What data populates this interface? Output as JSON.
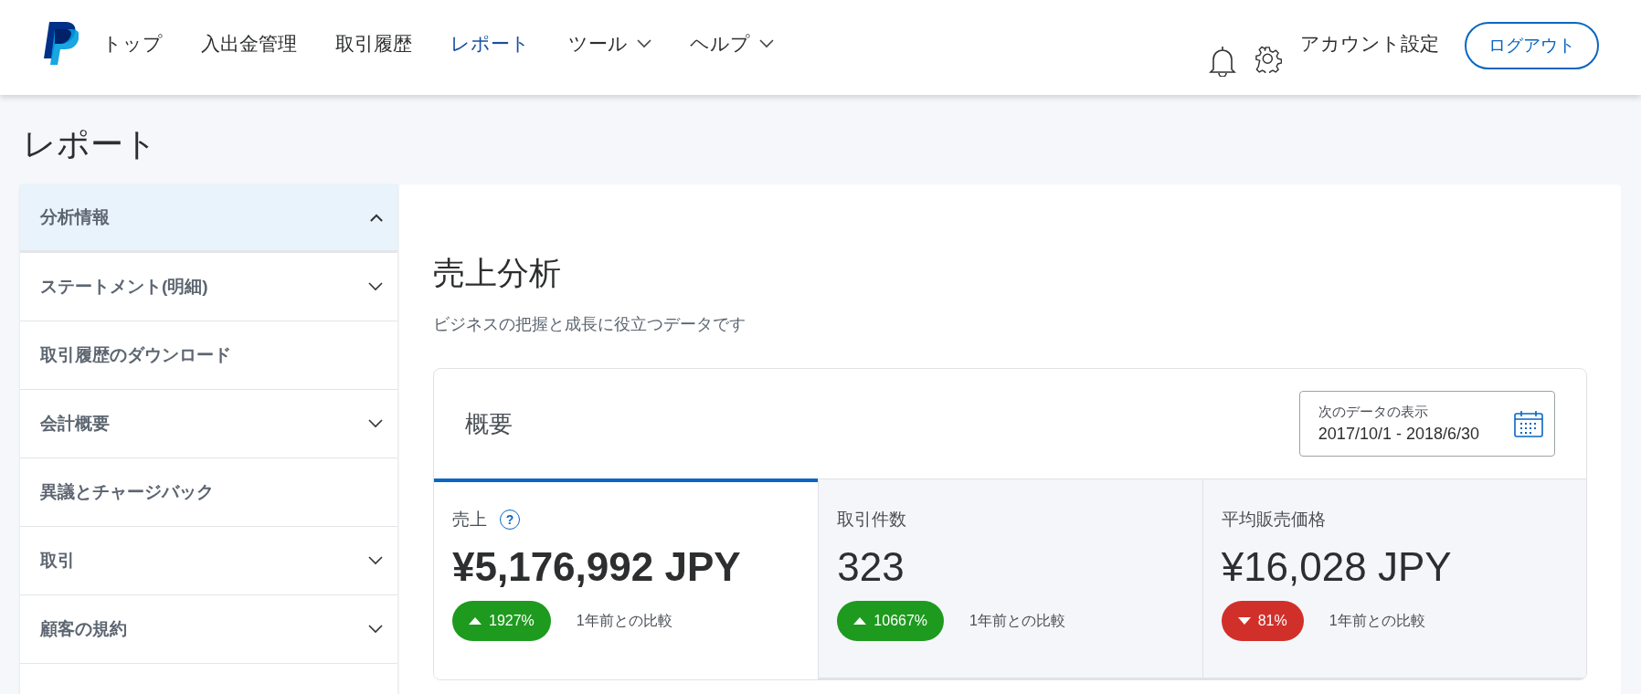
{
  "header": {
    "nav": [
      {
        "label": "トップ",
        "kind": "link",
        "selected": false
      },
      {
        "label": "入出金管理",
        "kind": "link",
        "selected": false
      },
      {
        "label": "取引履歴",
        "kind": "link",
        "selected": false
      },
      {
        "label": "レポート",
        "kind": "link",
        "selected": true
      },
      {
        "label": "ツール",
        "kind": "menu",
        "selected": false
      },
      {
        "label": "ヘルプ",
        "kind": "menu",
        "selected": false
      }
    ],
    "account_settings": "アカウント設定",
    "logout": "ログアウト"
  },
  "page_title": "レポート",
  "sidebar": {
    "items": [
      {
        "label": "分析情報",
        "kind": "expandable",
        "expanded": true,
        "selected": true
      },
      {
        "label": "ステートメント(明細)",
        "kind": "expandable",
        "expanded": false,
        "selected": false
      },
      {
        "label": "取引履歴のダウンロード",
        "kind": "link",
        "selected": false
      },
      {
        "label": "会計概要",
        "kind": "expandable",
        "expanded": false,
        "selected": false
      },
      {
        "label": "異議とチャージバック",
        "kind": "link",
        "selected": false
      },
      {
        "label": "取引",
        "kind": "expandable",
        "expanded": false,
        "selected": false
      },
      {
        "label": "顧客の規約",
        "kind": "expandable",
        "expanded": false,
        "selected": false
      }
    ]
  },
  "main": {
    "title": "売上分析",
    "subtitle": "ビジネスの把握と成長に役立つデータです",
    "overview": {
      "title": "概要",
      "date_range": {
        "label": "次のデータの表示",
        "value": "2017/10/1 - 2018/6/30"
      },
      "metrics": [
        {
          "label": "売上",
          "help": "?",
          "value": "¥5,176,992 JPY",
          "change": "1927%",
          "up": true,
          "comparison": "1年前との比較",
          "selected": true
        },
        {
          "label": "取引件数",
          "value": "323",
          "change": "10667%",
          "up": true,
          "comparison": "1年前との比較",
          "selected": false
        },
        {
          "label": "平均販売価格",
          "value": "¥16,028 JPY",
          "change": "81%",
          "up": false,
          "comparison": "1年前との比較",
          "selected": false
        }
      ]
    }
  }
}
